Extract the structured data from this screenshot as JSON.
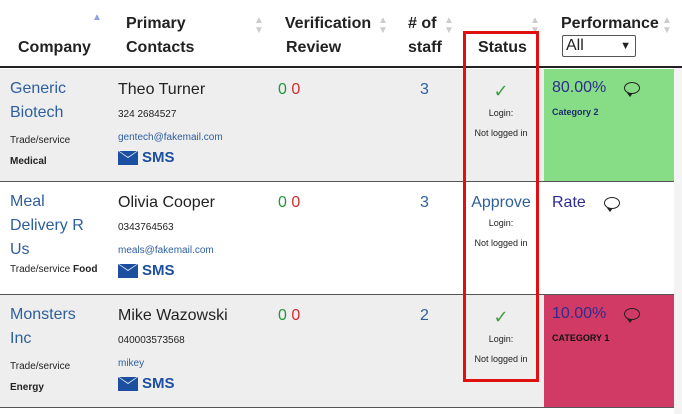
{
  "header": {
    "company": "Company",
    "primary_contacts_line1": "Primary",
    "primary_contacts_line2": "Contacts",
    "verification_line1": "Verification",
    "verification_line2": "Review",
    "staff_line1": "# of",
    "staff_line2": "staff",
    "status": "Status",
    "performance": "Performance",
    "performance_filter": "All"
  },
  "rows": [
    {
      "company_line1": "Generic",
      "company_line2": "Biotech",
      "type": "Trade/service",
      "sector": "Medical",
      "contact_name": "Theo Turner",
      "phone": "324 2684527",
      "email": "gentech@fakemail.com",
      "sms": "SMS",
      "ver_green": "0",
      "ver_red": "0",
      "staff": "3",
      "status_check": "✓",
      "login_label": "Login:",
      "login_state": "Not logged in",
      "perf_value": "80.00%",
      "perf_label": "Category 2",
      "perf_color": "#86dd86"
    },
    {
      "company_line1": "Meal",
      "company_line2": "Delivery R",
      "company_line3": "Us",
      "type": "Trade/service",
      "sector": "Food",
      "contact_name": "Olivia Cooper",
      "phone": "0343764563",
      "email": "meals@fakemail.com",
      "sms": "SMS",
      "ver_green": "0",
      "ver_red": "0",
      "staff": "3",
      "status_action": "Approve",
      "login_label": "Login:",
      "login_state": "Not logged in",
      "perf_value": "Rate",
      "perf_color": "#ffffff"
    },
    {
      "company_line1": "Monsters",
      "company_line2": "Inc",
      "type": "Trade/service",
      "sector": "Energy",
      "contact_name": "Mike Wazowski",
      "phone": "040003573568",
      "email": "mikey",
      "sms": "SMS",
      "ver_green": "0",
      "ver_red": "0",
      "staff": "2",
      "status_check": "✓",
      "login_label": "Login:",
      "login_state": "Not logged in",
      "perf_value": "10.00%",
      "perf_label": "CATEGORY 1",
      "perf_color": "#d23a66"
    }
  ],
  "icons": {
    "sort": "sort-icon",
    "envelope": "envelope-icon",
    "comment": "comment-icon",
    "check": "check-icon"
  },
  "colors": {
    "highlight": "#e01010",
    "link": "#2d5f9e",
    "green": "#22963d",
    "red": "#d62b2b"
  }
}
